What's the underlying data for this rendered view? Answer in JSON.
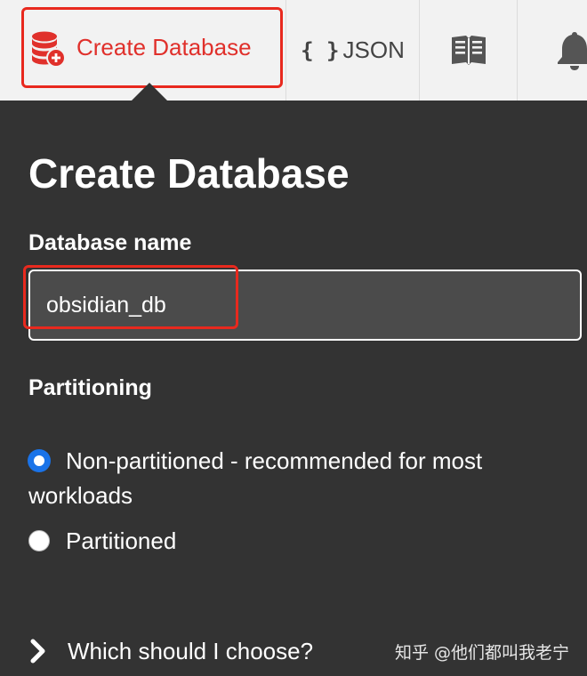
{
  "toolbar": {
    "create_label": "Create Database",
    "json_braces": "{ }",
    "json_label": "JSON",
    "icons": {
      "create": "database-add-icon",
      "docs": "book-icon",
      "notifications": "bell-icon"
    }
  },
  "form": {
    "title": "Create Database",
    "name_label": "Database name",
    "name_value": "obsidian_db",
    "partitioning_label": "Partitioning",
    "options": [
      {
        "label": "Non-partitioned - recommended for most workloads",
        "selected": true
      },
      {
        "label": "Partitioned",
        "selected": false
      }
    ],
    "help_link": "Which should I choose?"
  },
  "watermark": "知乎 @他们都叫我老宁",
  "colors": {
    "accent_red": "#e0302b",
    "highlight_red": "#e8291e",
    "panel_bg": "#333333",
    "toolbar_bg": "#f2f2f2",
    "radio_blue": "#1a73e8"
  }
}
